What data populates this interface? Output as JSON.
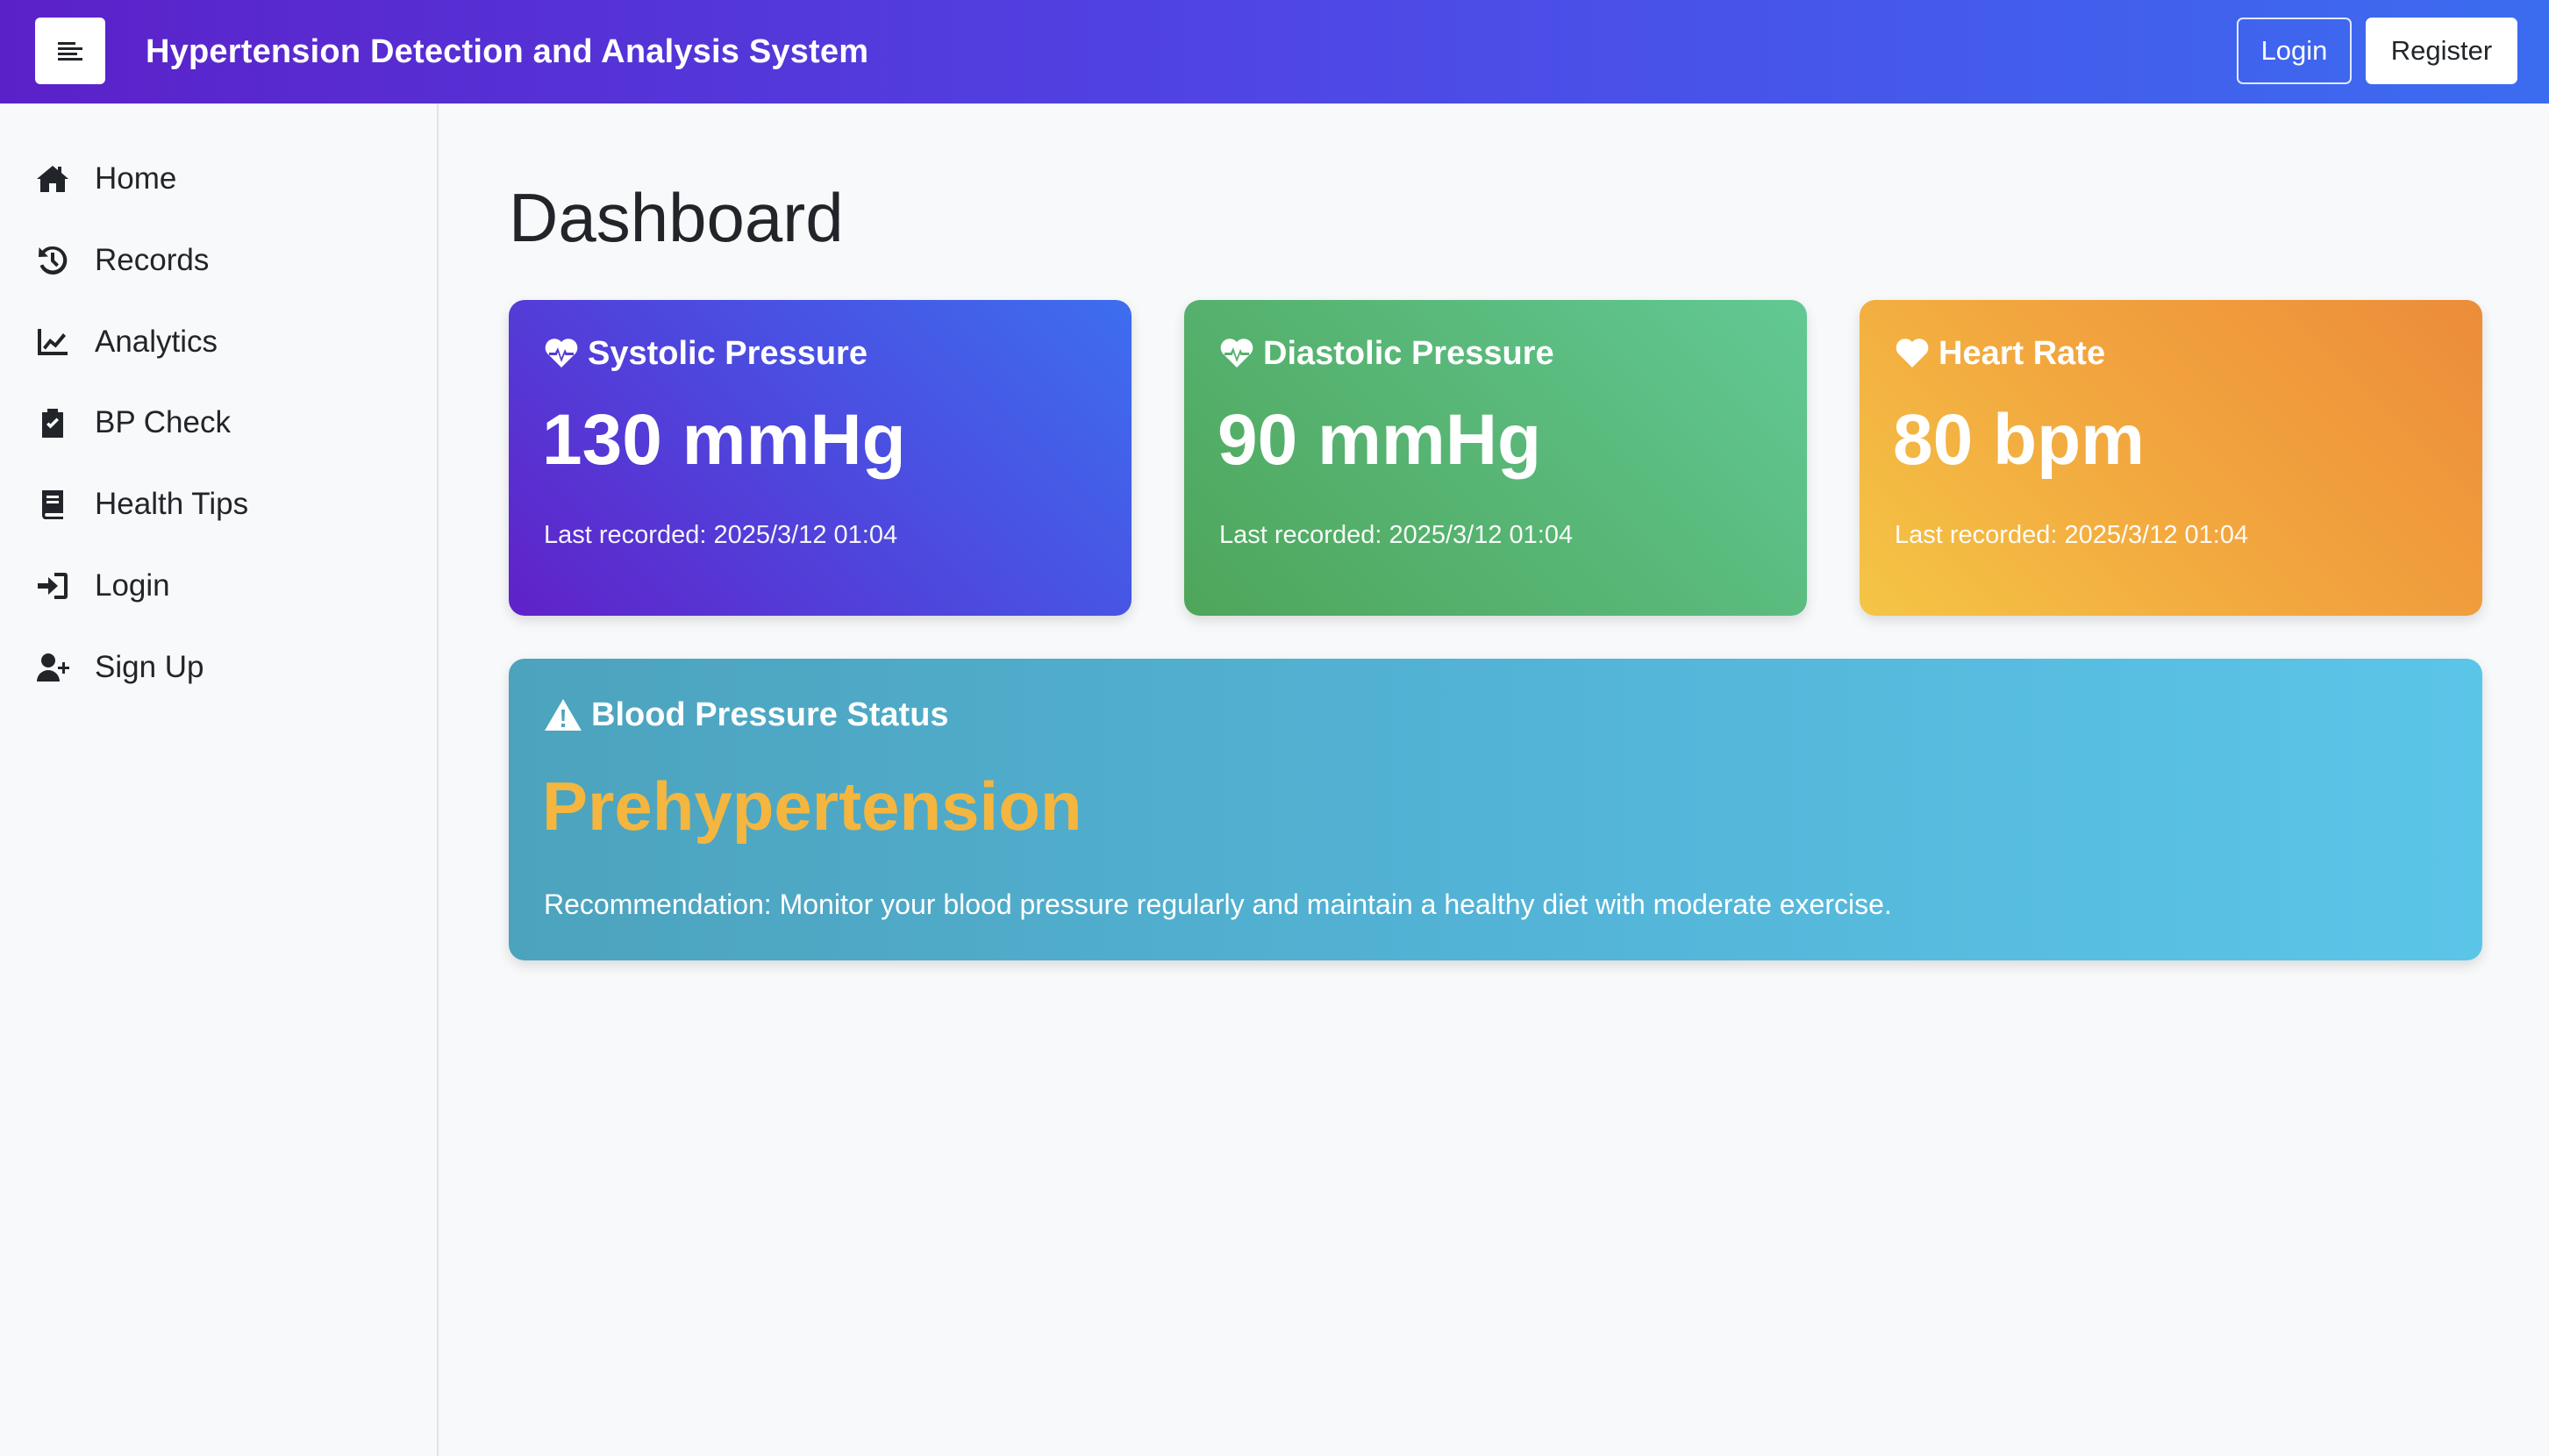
{
  "app": {
    "title": "Hypertension Detection and Analysis System",
    "menu_icon": "hamburger-menu-icon"
  },
  "header": {
    "login_label": "Login",
    "register_label": "Register"
  },
  "sidebar": {
    "items": [
      {
        "label": "Home",
        "icon": "home-icon"
      },
      {
        "label": "Records",
        "icon": "history-icon"
      },
      {
        "label": "Analytics",
        "icon": "chart-line-icon"
      },
      {
        "label": "BP Check",
        "icon": "clipboard-check-icon"
      },
      {
        "label": "Health Tips",
        "icon": "book-icon"
      },
      {
        "label": "Login",
        "icon": "sign-in-icon"
      },
      {
        "label": "Sign Up",
        "icon": "user-plus-icon"
      }
    ]
  },
  "main": {
    "page_title": "Dashboard",
    "cards": [
      {
        "title": "Systolic Pressure",
        "value": "130 mmHg",
        "last_recorded": "Last recorded: 2025/3/12 01:04",
        "icon": "heartbeat-icon"
      },
      {
        "title": "Diastolic Pressure",
        "value": "90 mmHg",
        "last_recorded": "Last recorded: 2025/3/12 01:04",
        "icon": "heartbeat-icon"
      },
      {
        "title": "Heart Rate",
        "value": "80 bpm",
        "last_recorded": "Last recorded: 2025/3/12 01:04",
        "icon": "heart-icon"
      }
    ],
    "status": {
      "title": "Blood Pressure Status",
      "value": "Prehypertension",
      "recommendation": "Recommendation: Monitor your blood pressure regularly and maintain a healthy diet with moderate exercise.",
      "icon": "warning-triangle-icon"
    }
  },
  "colors": {
    "navbar_start": "#5b21c9",
    "navbar_end": "#3b6cf0",
    "systolic_card": "#4f46e5",
    "diastolic_card": "#58b676",
    "heart_rate_card": "#f2a53e",
    "status_card": "#53b3d6",
    "status_text": "#f4b63f"
  }
}
